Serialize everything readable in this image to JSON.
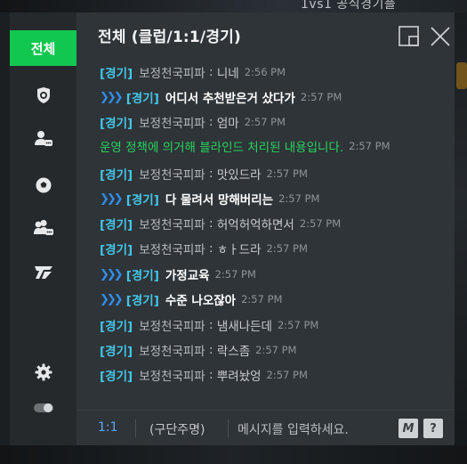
{
  "background": {
    "caption": "1vs1 공식경기플"
  },
  "chat": {
    "title": "전체 (클럽/1:1/경기)",
    "sidebar": {
      "active_label": "전체",
      "icons": [
        "shield-icon",
        "user-chat-icon",
        "soccer-ball-icon",
        "group-chat-icon",
        "team-logo-icon",
        "settings-icon",
        "toggle-icon"
      ]
    },
    "messages": [
      {
        "arrows": false,
        "tag": "[경기]",
        "sender": "보정천국피파",
        "sep": " : ",
        "text": "니네",
        "bold": false,
        "time": "2:56 PM"
      },
      {
        "arrows": true,
        "tag": "[경기]",
        "text": "어디서 추천받은거 샀다가",
        "bold": true,
        "time": "2:57 PM"
      },
      {
        "arrows": false,
        "tag": "[경기]",
        "sender": "보정천국피파",
        "sep": " : ",
        "text": "엄마",
        "bold": false,
        "time": "2:57 PM"
      },
      {
        "notice": true,
        "text": "운영 정책에 의거해 블라인드 처리된 내용입니다.",
        "time": "2:57 PM"
      },
      {
        "arrows": false,
        "tag": "[경기]",
        "sender": "보정천국피파",
        "sep": " : ",
        "text": "맛있드라",
        "bold": false,
        "time": "2:57 PM"
      },
      {
        "arrows": true,
        "tag": "[경기]",
        "text": "다 물려서 망해버리는",
        "bold": true,
        "time": "2:57 PM"
      },
      {
        "arrows": false,
        "tag": "[경기]",
        "sender": "보정천국피파",
        "sep": " : ",
        "text": "허억허억하면서",
        "bold": false,
        "time": "2:57 PM"
      },
      {
        "arrows": false,
        "tag": "[경기]",
        "sender": "보정천국피파",
        "sep": " : ",
        "text": "ㅎㅏ드라",
        "bold": false,
        "time": "2:57 PM"
      },
      {
        "arrows": true,
        "tag": "[경기]",
        "text": "가정교육",
        "bold": true,
        "time": "2:57 PM"
      },
      {
        "arrows": true,
        "tag": "[경기]",
        "text": "수준 나오잖아",
        "bold": true,
        "time": "2:57 PM"
      },
      {
        "arrows": false,
        "tag": "[경기]",
        "sender": "보정천국피파",
        "sep": " : ",
        "text": "냄새나든데",
        "bold": false,
        "time": "2:57 PM"
      },
      {
        "arrows": false,
        "tag": "[경기]",
        "sender": "보정천국피파",
        "sep": " : ",
        "text": "락스좀",
        "bold": false,
        "time": "2:57 PM"
      },
      {
        "arrows": false,
        "tag": "[경기]",
        "sender": "보정천국피파",
        "sep": " : ",
        "text": "뿌려놨엉",
        "bold": false,
        "time": "2:57 PM"
      }
    ],
    "input": {
      "mode": "1:1",
      "target": "(구단주명)",
      "placeholder": "메시지를 입력하세요.",
      "macro_label": "M",
      "help_label": "?"
    },
    "colors": {
      "accent_green": "#12c750",
      "tag_cyan": "#43c6e8",
      "arrow_blue": "#2f8ff0",
      "notice_green": "#27d35f"
    }
  }
}
